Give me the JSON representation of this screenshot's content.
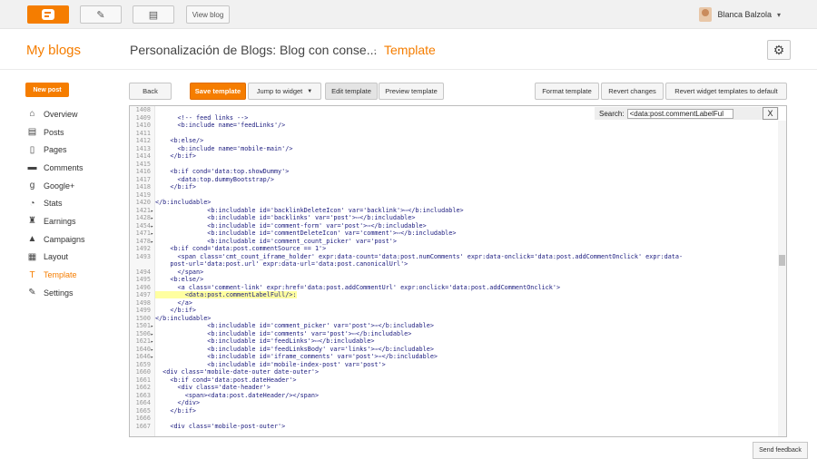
{
  "topbar": {
    "view_blog": "View blog",
    "user_name": "Blanca Balzola"
  },
  "header": {
    "my_blogs": "My blogs",
    "blog_title": "Personalización de Blogs: Blog con conse...",
    "separator": "·",
    "section": "Template"
  },
  "sidebar": {
    "new_post": "New post",
    "items": [
      {
        "label": "Overview",
        "icon": "home-icon",
        "glyph": "⌂"
      },
      {
        "label": "Posts",
        "icon": "posts-icon",
        "glyph": "▤"
      },
      {
        "label": "Pages",
        "icon": "pages-icon",
        "glyph": "▯"
      },
      {
        "label": "Comments",
        "icon": "comments-icon",
        "glyph": "▬"
      },
      {
        "label": "Google+",
        "icon": "google-plus-icon",
        "glyph": "g"
      },
      {
        "label": "Stats",
        "icon": "stats-icon",
        "glyph": "◔"
      },
      {
        "label": "Earnings",
        "icon": "earnings-icon",
        "glyph": "♜"
      },
      {
        "label": "Campaigns",
        "icon": "campaigns-icon",
        "glyph": "▲"
      },
      {
        "label": "Layout",
        "icon": "layout-icon",
        "glyph": "▦"
      },
      {
        "label": "Template",
        "icon": "template-icon",
        "glyph": "T"
      },
      {
        "label": "Settings",
        "icon": "settings-icon",
        "glyph": "✎"
      }
    ]
  },
  "toolbar": {
    "back": "Back",
    "save": "Save template",
    "jump": "Jump to widget",
    "edit": "Edit template",
    "preview": "Preview template",
    "format": "Format template",
    "revert": "Revert changes",
    "revert_widgets": "Revert widget templates to default"
  },
  "search": {
    "label": "Search:",
    "value": "<data:post.commentLabelFul",
    "close": "X"
  },
  "feedback": "Send feedback",
  "colors": {
    "accent": "#f57d00",
    "highlight": "#ffffa0"
  },
  "code_lines": [
    {
      "n": "1408",
      "f": "",
      "t": ""
    },
    {
      "n": "1409",
      "f": "",
      "t": "      <!-- feed links -->"
    },
    {
      "n": "1410",
      "f": "",
      "t": "      <b:include name='feedLinks'/>"
    },
    {
      "n": "1411",
      "f": "",
      "t": ""
    },
    {
      "n": "1412",
      "f": "",
      "t": "    <b:else/>"
    },
    {
      "n": "1413",
      "f": "",
      "t": "      <b:include name='mobile-main'/>"
    },
    {
      "n": "1414",
      "f": "",
      "t": "    </b:if>"
    },
    {
      "n": "1415",
      "f": "",
      "t": ""
    },
    {
      "n": "1416",
      "f": "",
      "t": "    <b:if cond='data:top.showDummy'>"
    },
    {
      "n": "1417",
      "f": "",
      "t": "      <data:top.dummyBootstrap/>"
    },
    {
      "n": "1418",
      "f": "",
      "t": "    </b:if>"
    },
    {
      "n": "1419",
      "f": "",
      "t": ""
    },
    {
      "n": "1420",
      "f": "",
      "t": "</b:includable>"
    },
    {
      "n": "1421",
      "f": "▸",
      "t": "              <b:includable id='backlinkDeleteIcon' var='backlink'>⋯</b:includable>"
    },
    {
      "n": "1428",
      "f": "▸",
      "t": "              <b:includable id='backlinks' var='post'>⋯</b:includable>"
    },
    {
      "n": "1454",
      "f": "▸",
      "t": "              <b:includable id='comment-form' var='post'>⋯</b:includable>"
    },
    {
      "n": "1471",
      "f": "▸",
      "t": "              <b:includable id='commentDeleteIcon' var='comment'>⋯</b:includable>"
    },
    {
      "n": "1478",
      "f": "▸",
      "t": "              <b:includable id='comment_count_picker' var='post'>"
    },
    {
      "n": "1492",
      "f": "",
      "t": "    <b:if cond='data:post.commentSource == 1'>"
    },
    {
      "n": "1493",
      "f": "",
      "t": "      <span class='cmt_count_iframe_holder' expr:data-count='data:post.numComments' expr:data-onclick='data:post.addCommentOnclick' expr:data-"
    },
    {
      "n": "",
      "f": "",
      "t": "    post-url='data:post.url' expr:data-url='data:post.canonicalUrl'>"
    },
    {
      "n": "1494",
      "f": "",
      "t": "      </span>"
    },
    {
      "n": "1495",
      "f": "",
      "t": "    <b:else/>"
    },
    {
      "n": "1496",
      "f": "",
      "t": "      <a class='comment-link' expr:href='data:post.addCommentUrl' expr:onclick='data:post.addCommentOnclick'>"
    },
    {
      "n": "1497",
      "f": "",
      "t": "        <data:post.commentLabelFull/>:",
      "hl": true
    },
    {
      "n": "1498",
      "f": "",
      "t": "      </a>"
    },
    {
      "n": "1499",
      "f": "",
      "t": "    </b:if>"
    },
    {
      "n": "1500",
      "f": "",
      "t": "</b:includable>"
    },
    {
      "n": "1501",
      "f": "▸",
      "t": "              <b:includable id='comment_picker' var='post'>⋯</b:includable>"
    },
    {
      "n": "1506",
      "f": "▸",
      "t": "              <b:includable id='comments' var='post'>⋯</b:includable>"
    },
    {
      "n": "1621",
      "f": "▸",
      "t": "              <b:includable id='feedLinks'>⋯</b:includable>"
    },
    {
      "n": "1640",
      "f": "▸",
      "t": "              <b:includable id='feedLinksBody' var='links'>⋯</b:includable>"
    },
    {
      "n": "1646",
      "f": "▸",
      "t": "              <b:includable id='iframe_comments' var='post'>⋯</b:includable>"
    },
    {
      "n": "1659",
      "f": "",
      "t": "              <b:includable id='mobile-index-post' var='post'>"
    },
    {
      "n": "1660",
      "f": "",
      "t": "  <div class='mobile-date-outer date-outer'>"
    },
    {
      "n": "1661",
      "f": "",
      "t": "    <b:if cond='data:post.dateHeader'>"
    },
    {
      "n": "1662",
      "f": "",
      "t": "      <div class='date-header'>"
    },
    {
      "n": "1663",
      "f": "",
      "t": "        <span><data:post.dateHeader/></span>"
    },
    {
      "n": "1664",
      "f": "",
      "t": "      </div>"
    },
    {
      "n": "1665",
      "f": "",
      "t": "    </b:if>"
    },
    {
      "n": "1666",
      "f": "",
      "t": ""
    },
    {
      "n": "1667",
      "f": "",
      "t": "    <div class='mobile-post-outer'>"
    }
  ]
}
